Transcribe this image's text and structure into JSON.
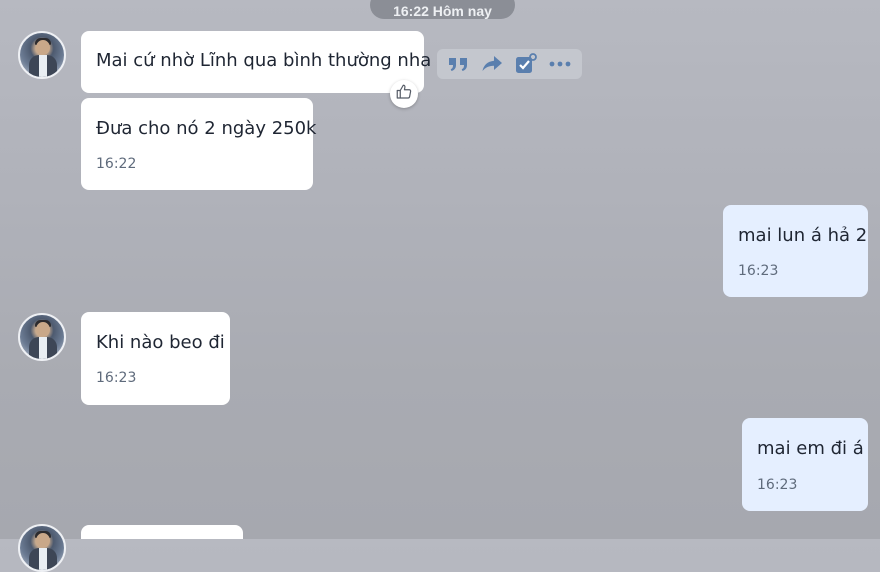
{
  "date_divider": "16:22 Hôm nay",
  "actions": {
    "icons": [
      "quote-icon",
      "forward-icon",
      "task-check-icon",
      "more-icon"
    ]
  },
  "messages": [
    {
      "direction": "in",
      "text": "Mai cứ nhờ Lĩnh qua bình thường nha",
      "reaction": "like-icon"
    },
    {
      "direction": "in",
      "text": "Đưa cho nó 2 ngày 250k",
      "time": "16:22"
    },
    {
      "direction": "out",
      "text": "mai lun á hả 2",
      "time": "16:23"
    },
    {
      "direction": "in",
      "text": "Khi nào beo đi",
      "time": "16:23"
    },
    {
      "direction": "out",
      "text": "mai em đi á",
      "time": "16:23"
    }
  ],
  "colors": {
    "incoming_bubble": "#ffffff",
    "outgoing_bubble": "#e5efff",
    "action_icon": "#5a7fae"
  }
}
